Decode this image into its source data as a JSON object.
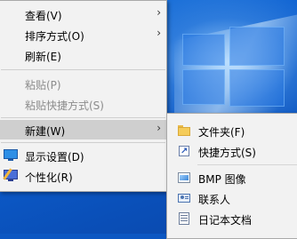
{
  "main_menu": {
    "items": [
      {
        "label": "查看(V)",
        "disabled": false,
        "has_submenu": true
      },
      {
        "label": "排序方式(O)",
        "disabled": false,
        "has_submenu": true
      },
      {
        "label": "刷新(E)",
        "disabled": false,
        "has_submenu": false
      },
      {
        "label": "粘贴(P)",
        "disabled": true,
        "has_submenu": false
      },
      {
        "label": "粘贴快捷方式(S)",
        "disabled": true,
        "has_submenu": false
      },
      {
        "label": "新建(W)",
        "disabled": false,
        "has_submenu": true,
        "highlighted": true
      },
      {
        "label": "显示设置(D)",
        "disabled": false,
        "icon": "display-settings-icon"
      },
      {
        "label": "个性化(R)",
        "disabled": false,
        "icon": "personalize-icon"
      }
    ],
    "submenu_arrow": "›"
  },
  "new_submenu": {
    "items": [
      {
        "label": "文件夹(F)",
        "icon": "folder-icon"
      },
      {
        "label": "快捷方式(S)",
        "icon": "shortcut-icon"
      },
      {
        "label": "BMP 图像",
        "icon": "bitmap-image-icon"
      },
      {
        "label": "联系人",
        "icon": "contact-icon"
      },
      {
        "label": "日记本文档",
        "icon": "journal-document-icon"
      }
    ]
  },
  "colors": {
    "menu_bg": "#f2f2f2",
    "highlight": "#cfcfcf",
    "disabled_text": "#8c8c8c",
    "desktop": "#0c57c2"
  }
}
